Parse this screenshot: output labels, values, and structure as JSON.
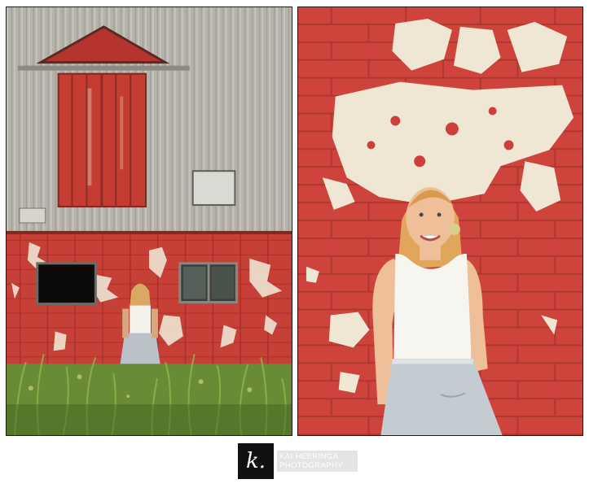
{
  "watermark": {
    "logo_letter": "k.",
    "name_line": "KAI HEERINGA",
    "tag_line": "PHOTOGRAPHY"
  },
  "photos": [
    {
      "id": "left",
      "subject": "barn-wall-with-girl"
    },
    {
      "id": "right",
      "subject": "girl-against-red-brick-wall"
    }
  ],
  "colors": {
    "barn_red": "#c9403a",
    "metal_grey": "#b9b6ae",
    "grass_green": "#6c8f3a",
    "white_paint": "#e9ddc7"
  }
}
